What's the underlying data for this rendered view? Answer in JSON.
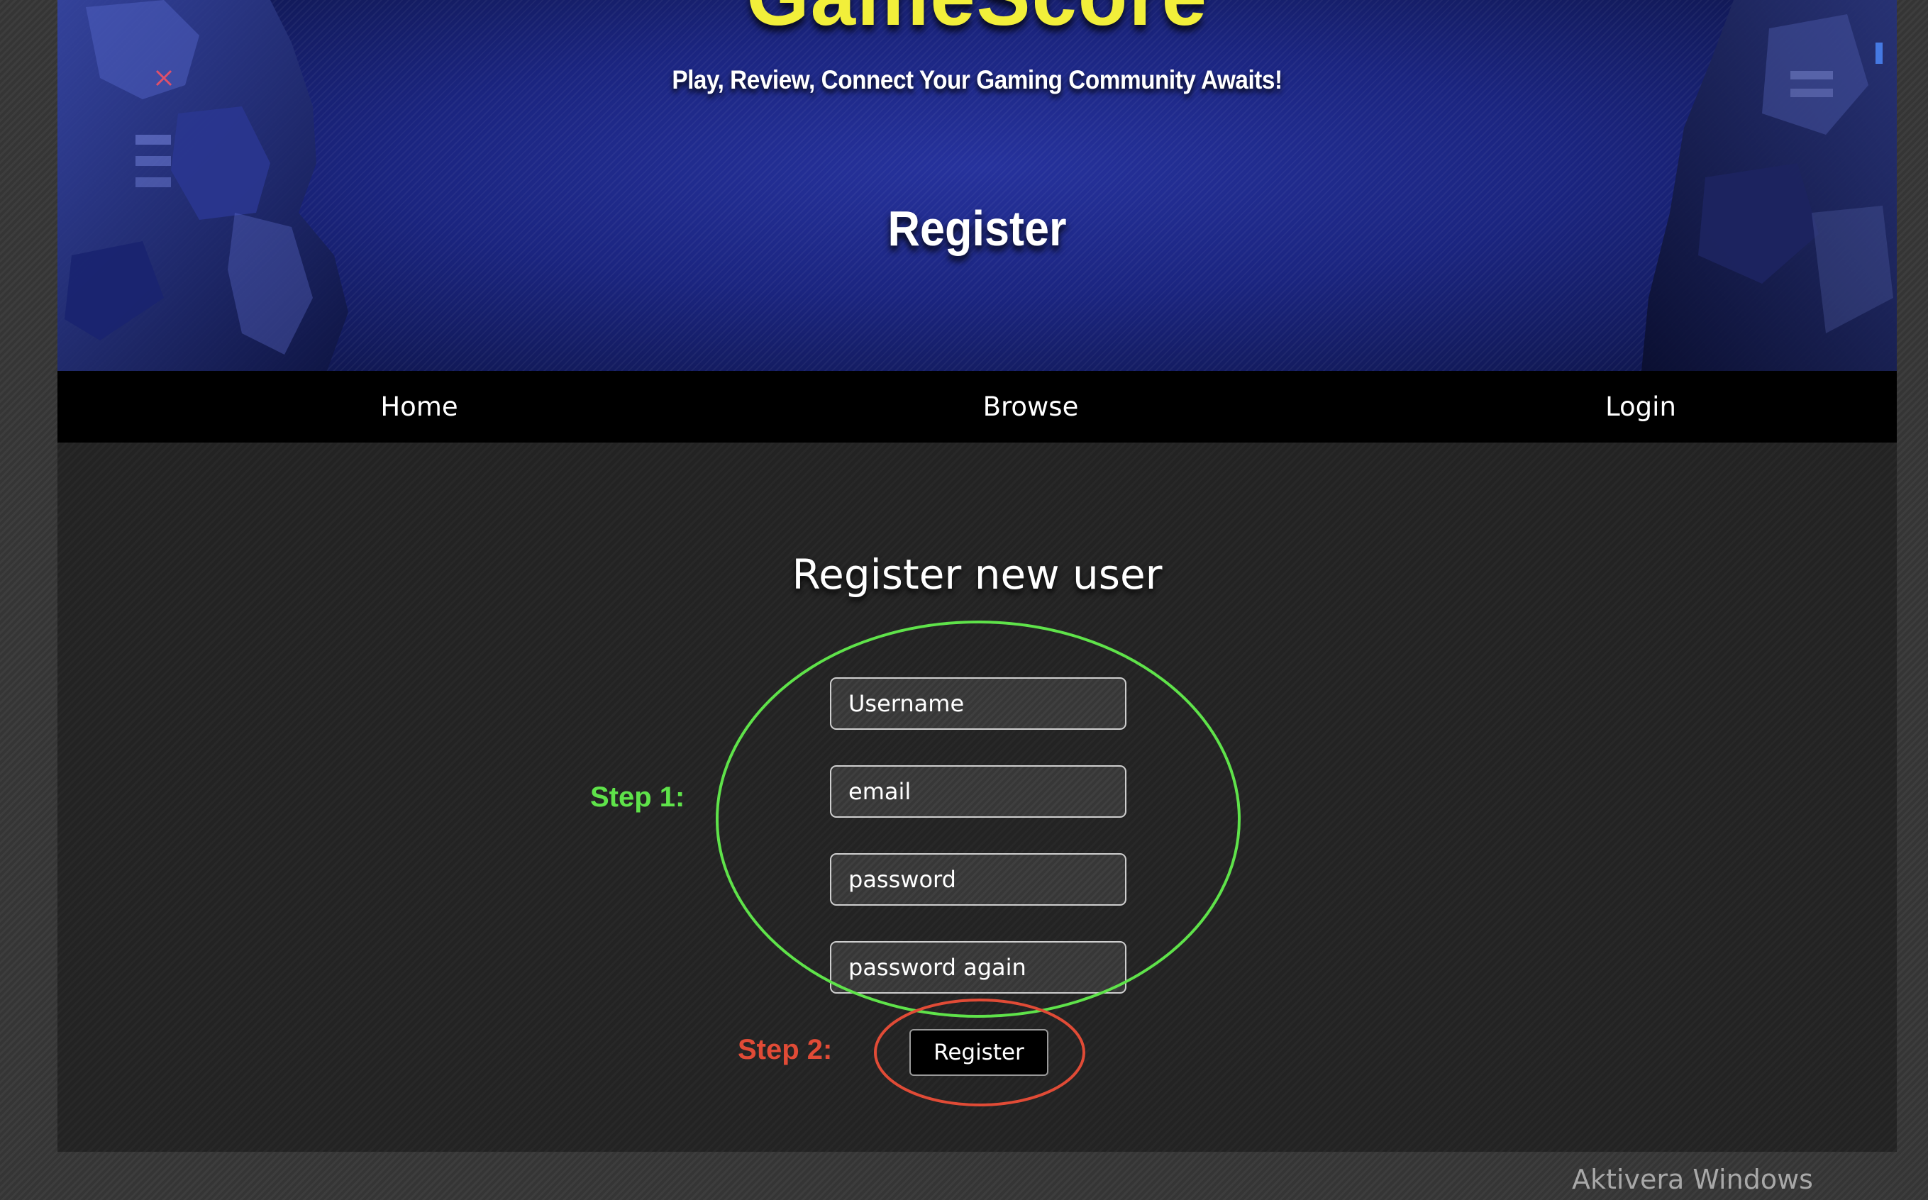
{
  "header": {
    "site_title": "GameScore",
    "tagline": "Play, Review, Connect Your Gaming Community Awaits!",
    "page_heading": "Register"
  },
  "nav": {
    "home": "Home",
    "browse": "Browse",
    "login": "Login"
  },
  "form": {
    "title": "Register new user",
    "username_placeholder": "Username",
    "email_placeholder": "email",
    "password_placeholder": "password",
    "password_again_placeholder": "password again",
    "submit_label": "Register"
  },
  "annotations": {
    "step1": "Step 1:",
    "step2": "Step 2:"
  },
  "os_watermark": "Aktivera Windows",
  "colors": {
    "banner_blue": "#1b2580",
    "title_yellow": "#f2ef3a",
    "step1_green": "#5fe34a",
    "step2_red": "#e14b36"
  }
}
